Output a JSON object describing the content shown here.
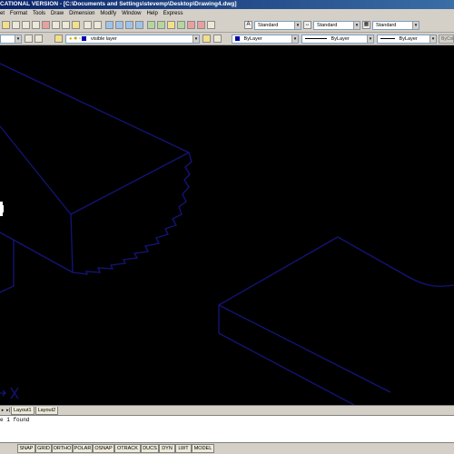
{
  "window": {
    "title": "CATIONAL VERSION - [C:\\Documents and Settings\\stevemp\\Desktop\\Drawing4.dwg]"
  },
  "menu": [
    "et",
    "Format",
    "Tools",
    "Draw",
    "Dimension",
    "Modify",
    "Window",
    "Help",
    "Express"
  ],
  "styles": {
    "text_style": "Standard",
    "dim_style": "Standard",
    "table_style": "Standard"
  },
  "layers": {
    "current": "visible layer",
    "color": "ByLayer",
    "linetype": "ByLayer",
    "lineweight": "ByLayer",
    "plot_style": "ByColor"
  },
  "colors": {
    "layer_swatch": "#0000aa",
    "lines": "#14147a"
  },
  "tabs": {
    "layout1": "Layout1",
    "layout2": "Layout2"
  },
  "command": {
    "line1": "e 1 found",
    "line2": "",
    "line3": ""
  },
  "status": {
    "buttons": [
      "SNAP",
      "GRID",
      "ORTHO",
      "POLAR",
      "OSNAP",
      "OTRACK",
      "DUCS",
      "DYN",
      "LWT",
      "MODEL"
    ]
  }
}
